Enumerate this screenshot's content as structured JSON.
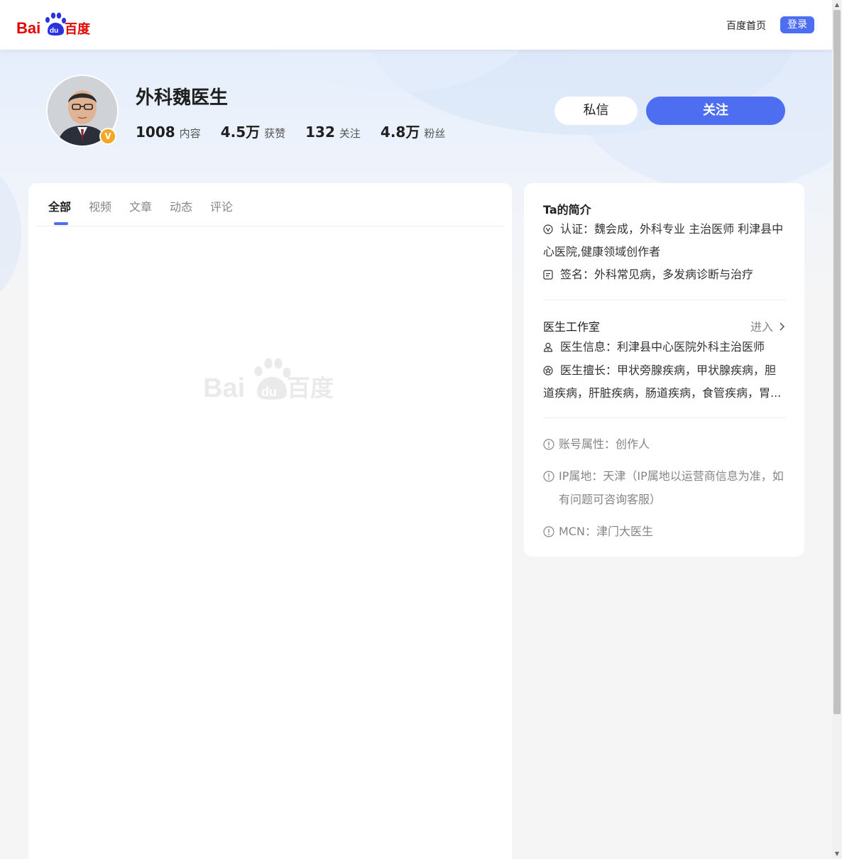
{
  "header": {
    "logo": {
      "text_left": "Bai",
      "text_paw": "du",
      "text_right": "百度"
    },
    "home_link": "百度首页",
    "login_label": "登录"
  },
  "profile": {
    "name": "外科魏医生",
    "verified_badge": "V",
    "stats": [
      {
        "num": "1008",
        "label": "内容"
      },
      {
        "num": "4.5万",
        "label": "获赞"
      },
      {
        "num": "132",
        "label": "关注"
      },
      {
        "num": "4.8万",
        "label": "粉丝"
      }
    ],
    "message_label": "私信",
    "follow_label": "关注"
  },
  "tabs": [
    {
      "label": "全部",
      "active": true
    },
    {
      "label": "视频",
      "active": false
    },
    {
      "label": "文章",
      "active": false
    },
    {
      "label": "动态",
      "active": false
    },
    {
      "label": "评论",
      "active": false
    }
  ],
  "intro": {
    "title": "Ta的简介",
    "certification": "认证：魏会成，外科专业 主治医师 利津县中心医院,健康领域创作者",
    "signature": "签名：外科常见病，多发病诊断与治疗"
  },
  "studio": {
    "title": "医生工作室",
    "enter_label": "进入",
    "doctor_info": "医生信息：利津县中心医院外科主治医师",
    "specialty": "医生擅长：甲状旁腺疾病，甲状腺疾病，胆道疾病，肝脏疾病，肠道疾病，食管疾病，胃..."
  },
  "attributes": {
    "account_type": "账号属性：创作人",
    "ip_location": "IP属地：天津（IP属地以运营商信息为准，如有问题可咨询客服）",
    "mcn": "MCN：津门大医生"
  },
  "colors": {
    "accent": "#4e6ef2",
    "badge": "#f5a623",
    "logo_red": "#e10602",
    "logo_blue": "#2932e1"
  }
}
